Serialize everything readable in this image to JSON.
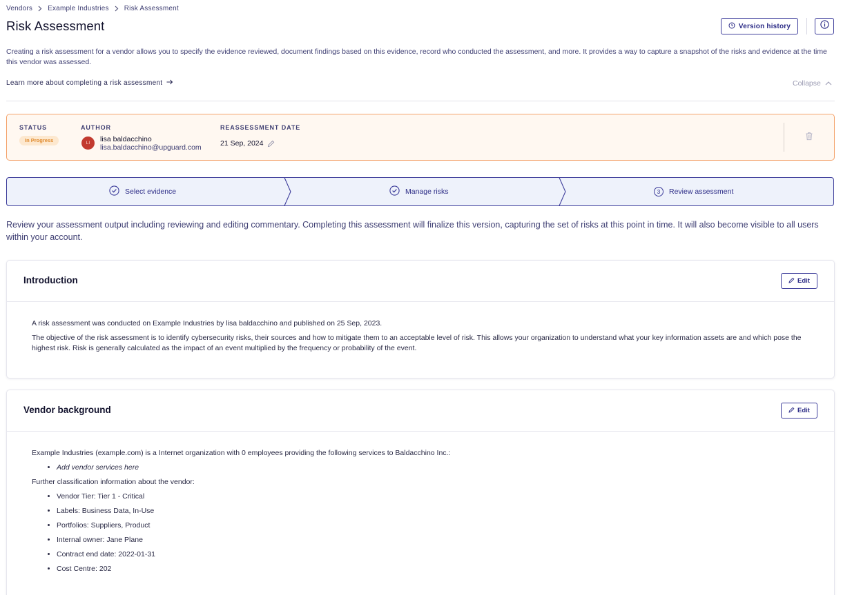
{
  "breadcrumb": {
    "items": [
      "Vendors",
      "Example Industries",
      "Risk Assessment"
    ]
  },
  "page_title": "Risk Assessment",
  "header_actions": {
    "version_history_label": "Version history"
  },
  "description": "Creating a risk assessment for a vendor allows you to specify the evidence reviewed, document findings based on this evidence, record who conducted the assessment, and more. It provides a way to capture a snapshot of the risks and evidence at the time this vendor was assessed.",
  "learn_more_label": "Learn more about completing a risk assessment",
  "collapse_label": "Collapse",
  "status_card": {
    "status_label": "STATUS",
    "status_value": "In Progress",
    "author_label": "AUTHOR",
    "author_initials": "LI",
    "author_name": "lisa baldacchino",
    "author_email": "lisa.baldacchino@upguard.com",
    "reassessment_label": "REASSESSMENT DATE",
    "reassessment_date": "21 Sep, 2024"
  },
  "stepper": {
    "steps": [
      {
        "label": "Select evidence",
        "state": "done"
      },
      {
        "label": "Manage risks",
        "state": "done"
      },
      {
        "label": "Review assessment",
        "state": "current",
        "number": "3"
      }
    ]
  },
  "review_text": "Review your assessment output including reviewing and editing commentary. Completing this assessment will finalize this version, capturing the set of risks at this point in time. It will also become visible to all users within your account.",
  "sections": {
    "introduction": {
      "title": "Introduction",
      "edit_label": "Edit",
      "paragraphs": [
        "A risk assessment was conducted on Example Industries by lisa baldacchino and published on 25 Sep, 2023.",
        "The objective of the risk assessment is to identify cybersecurity risks, their sources and how to mitigate them to an acceptable level of risk. This allows your organization to understand what your key information assets are and which pose the highest risk. Risk is generally calculated as the impact of an event multiplied by the frequency or probability of the event."
      ]
    },
    "vendor_background": {
      "title": "Vendor background",
      "edit_label": "Edit",
      "intro": "Example Industries (example.com) is a Internet organization with 0 employees providing the following services to Baldacchino Inc.:",
      "services": [
        "Add vendor services here"
      ],
      "classification_intro": "Further classification information about the vendor:",
      "classification": [
        "Vendor Tier: Tier 1 - Critical",
        "Labels: Business Data, In-Use",
        "Portfolios: Suppliers, Product",
        "Internal owner: Jane Plane",
        "Contract end date: 2022-01-31",
        "Cost Centre: 202"
      ]
    }
  },
  "colors": {
    "accent": "#3c3c9a",
    "status_border": "#f4a26a",
    "status_bg": "#fff8f1",
    "badge_bg": "#fde8cf",
    "badge_text": "#e08a2d",
    "stepper_bg": "#eef2fb",
    "avatar": "#c23a2f"
  },
  "icons": {
    "breadcrumb_separator": "chevron-right-icon",
    "version_history": "clock-icon",
    "info": "info-icon",
    "learn_more": "arrow-right-icon",
    "collapse": "chevron-up-icon",
    "edit_date": "pencil-icon",
    "delete": "trash-icon",
    "step_done": "check-circle-icon",
    "edit": "pencil-icon"
  }
}
